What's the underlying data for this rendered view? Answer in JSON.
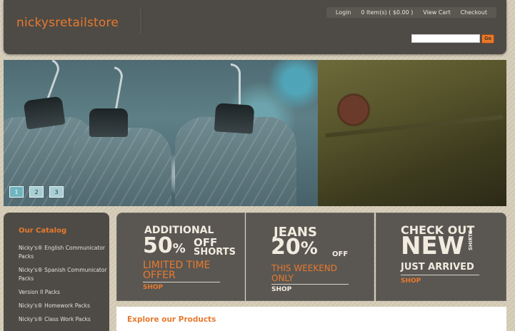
{
  "header": {
    "logo": "nickysretailstore",
    "nav": {
      "login": "Login",
      "cart_summary": "0 Item(s)  ( $0.00 )",
      "view_cart": "View Cart",
      "checkout": "Checkout"
    },
    "search": {
      "value": "",
      "placeholder": "",
      "button": "Go"
    }
  },
  "slider": {
    "pages": [
      "1",
      "2",
      "3"
    ],
    "active_page": "1"
  },
  "sidebar": {
    "title": "Our Catalog",
    "items": [
      "Nicky's® English Communicator Packs",
      "Nicky's® Spanish Communicator Packs",
      "Version II Packs",
      "Nicky's® Homework Packs",
      "Nicky's® Class Work Packs"
    ]
  },
  "promos": [
    {
      "line1": "ADDITIONAL",
      "big": "50",
      "pct": "%",
      "off": "OFF",
      "item": "SHORTS",
      "sub1": "LIMITED TIME",
      "sub2": "OFFER",
      "cta": "SHOP"
    },
    {
      "line1": "JEANS",
      "big": "20",
      "pct": "%",
      "off": "OFF",
      "sub1": "THIS WEEKEND",
      "sub2": "ONLY",
      "cta": "SHOP"
    },
    {
      "line1": "CHECK OUT",
      "big": "NEW",
      "side": "SHIRTS",
      "sub1": "JUST ARRIVED",
      "cta": "SHOP"
    }
  ],
  "explore": {
    "title": "Explore our Products"
  },
  "colors": {
    "accent": "#e8792d",
    "panel": "#4e4b46",
    "promo": "#5a5753"
  }
}
